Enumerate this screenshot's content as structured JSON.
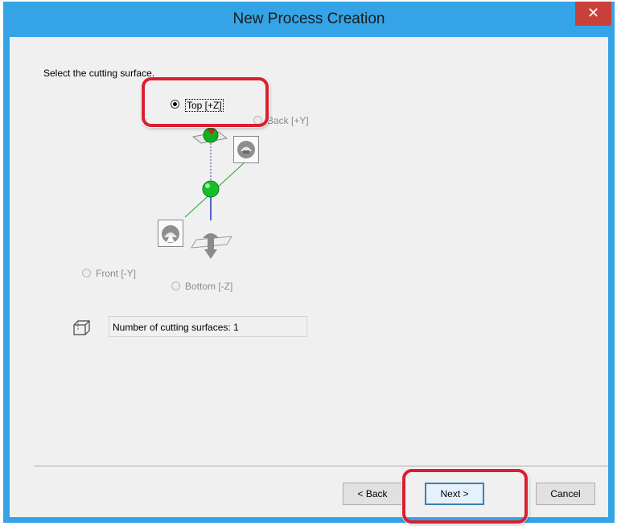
{
  "window": {
    "title": "New Process Creation",
    "close_glyph": "✕"
  },
  "dialog": {
    "prompt": "Select the cutting surface.",
    "options": {
      "top": {
        "label": "Top [+Z]",
        "selected": true,
        "enabled": true
      },
      "back": {
        "label": "Back [+Y]",
        "selected": false,
        "enabled": false
      },
      "front": {
        "label": "Front [-Y]",
        "selected": false,
        "enabled": false
      },
      "bottom": {
        "label": "Bottom [-Z]",
        "selected": false,
        "enabled": false
      }
    },
    "surface_count_text": "Number of cutting surfaces: 1",
    "icons": [
      "cube-outline-icon",
      "axis-diagram-icon",
      "view-top-icon",
      "view-front-icon",
      "tool-icon"
    ]
  },
  "buttons": {
    "back": "< Back",
    "next": "Next >",
    "cancel": "Cancel"
  },
  "colors": {
    "titlebar": "#34a4e6",
    "close": "#c9403a",
    "highlight": "#d8202f",
    "client": "#f0f0f0"
  }
}
